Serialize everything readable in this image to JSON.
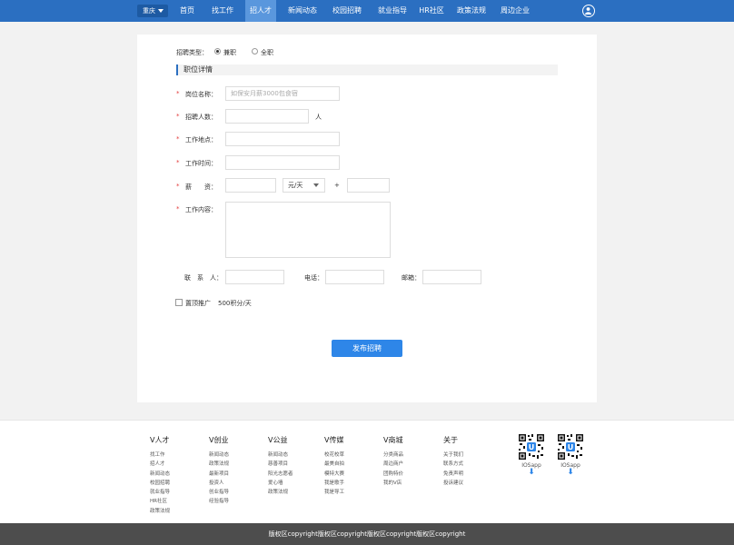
{
  "nav": {
    "city": "重庆",
    "items": [
      {
        "label": "首页"
      },
      {
        "label": "找工作"
      },
      {
        "label": "招人才",
        "active": true
      },
      {
        "label": "新闻动态"
      },
      {
        "label": "校园招聘"
      },
      {
        "label": "就业指导"
      },
      {
        "label": "HR社区"
      },
      {
        "label": "政策法规"
      },
      {
        "label": "周边企业"
      }
    ],
    "user_icon": "user-circle-icon"
  },
  "form": {
    "type_label": "招聘类型：",
    "type_options": [
      "兼职",
      "全职"
    ],
    "type_selected": "兼职",
    "section_title": "职位详情",
    "required_mark": "*",
    "job_name_label": "岗位名称：",
    "job_name_placeholder": "如保安月薪3000包食宿",
    "headcount_label": "招聘人数：",
    "headcount_unit": "人",
    "location_label": "工作地点：",
    "time_label": "工作时间：",
    "salary_label": "薪　　资：",
    "salary_unit": "元/天",
    "salary_plus": "+",
    "content_label": "工作内容：",
    "contact_label": "联　系　人：",
    "phone_label": "电话：",
    "email_label": "邮箱：",
    "promote_label": "置顶推广",
    "promote_price": "500积分/天",
    "submit_label": "发布招聘"
  },
  "footer": {
    "columns": [
      {
        "title": "V人才",
        "items": [
          "找工作",
          "招人才",
          "新闻动态",
          "校园招聘",
          "就业指导",
          "HR社区",
          "政策法规"
        ]
      },
      {
        "title": "V创业",
        "items": [
          "新闻动态",
          "政策法规",
          "最新项目",
          "投资人",
          "创业指导",
          "经验指导"
        ]
      },
      {
        "title": "V公益",
        "items": [
          "新闻动态",
          "慈善项目",
          "阳光志愿者",
          "爱心墙",
          "政策法规"
        ]
      },
      {
        "title": "V传媒",
        "items": [
          "校花校草",
          "最美自拍",
          "模特大赛",
          "我是歌手",
          "我是导工"
        ]
      },
      {
        "title": "V商城",
        "items": [
          "分类商品",
          "周边商户",
          "团购特价",
          "我的V店"
        ]
      },
      {
        "title": "关于",
        "items": [
          "关于我们",
          "联系方式",
          "免责声明",
          "投诉建议"
        ]
      }
    ],
    "apps": [
      {
        "label": "IOSapp"
      },
      {
        "label": "IOSapp"
      }
    ],
    "copyright": "版权区copyright版权区copyright版权区copyright版权区copyright"
  },
  "colors": {
    "nav_bg": "#2b6fc1",
    "nav_active": "#5a97dd",
    "primary_button": "#2e86e8",
    "required": "#e23a3a",
    "copyright_bg": "#4d4d4d"
  }
}
